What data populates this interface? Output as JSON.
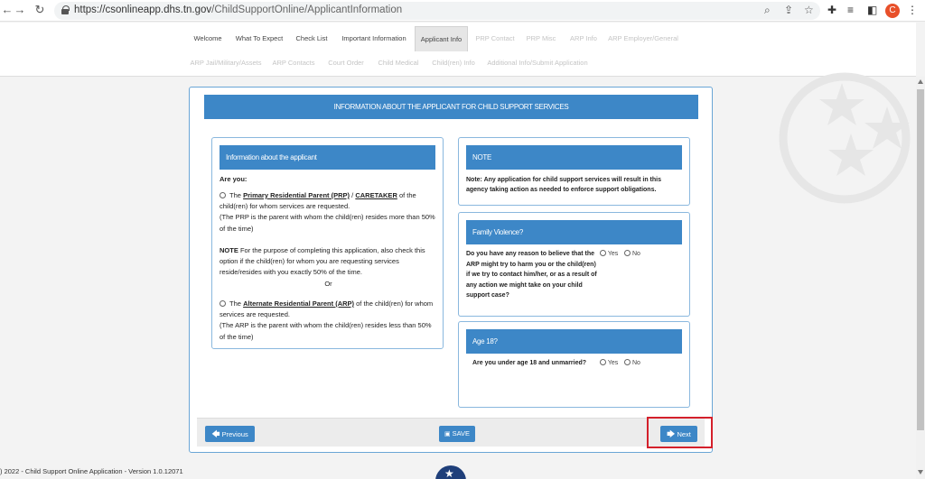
{
  "browser": {
    "url_host": "https://csonlineapp.dhs.tn.gov",
    "url_path": "/ChildSupportOnline/ApplicantInformation",
    "profile_initial": "C"
  },
  "nav_row1": [
    "Welcome",
    "What To Expect",
    "Check List",
    "Important Information",
    "Applicant Info",
    "PRP Contact",
    "PRP Misc",
    "ARP Info",
    "ARP Employer/General"
  ],
  "nav_row2": [
    "ARP Jail/Military/Assets",
    "ARP Contacts",
    "Court Order",
    "Child Medical",
    "Child(ren) Info",
    "Additional Info/Submit Application"
  ],
  "banner": "INFORMATION ABOUT THE APPLICANT FOR CHILD SUPPORT SERVICES",
  "applicant": {
    "heading": "Information about the applicant",
    "are_you": "Are you:",
    "opt1_the": "The",
    "opt1_prp": "Primary Residential Parent (PRP)",
    "opt1_slash": "/",
    "opt1_caretaker": "CARETAKER",
    "opt1_rest": "of the child(ren) for whom services are requested.",
    "opt1_note": "(The PRP is the parent with whom the child(ren) resides more than 50% of the time)",
    "note_label": "NOTE",
    "note_text": "For the purpose of completing this application, also check this option if the child(ren) for whom you are requesting services reside/resides with you exactly 50% of the time.",
    "or": "Or",
    "opt2_the": "The",
    "opt2_arp": "Alternate Residential Parent (ARP)",
    "opt2_rest": "of the child(ren) for whom services are requested.",
    "opt2_note": "(The ARP is the parent with whom the child(ren) resides less than 50% of the time)"
  },
  "note_panel": {
    "heading": "NOTE",
    "text": "Note: Any application for child support services will result in this agency taking action as needed to enforce support obligations."
  },
  "violence": {
    "heading": "Family Violence?",
    "question": "Do you have any reason to believe that the ARP might try to harm you or the child(ren) if we try to contact him/her, or as a result of any action we might take on your child support case?",
    "yes": "Yes",
    "no": "No"
  },
  "age": {
    "heading": "Age 18?",
    "question": "Are you under age 18 and unmarried?",
    "yes": "Yes",
    "no": "No"
  },
  "buttons": {
    "previous": "Previous",
    "save": "SAVE",
    "next": "Next"
  },
  "footer": ") 2022 - Child Support Online Application - Version 1.0.12071",
  "colors": {
    "primary": "#3d87c7",
    "highlight": "#d4202b",
    "avatar": "#e8502a"
  }
}
